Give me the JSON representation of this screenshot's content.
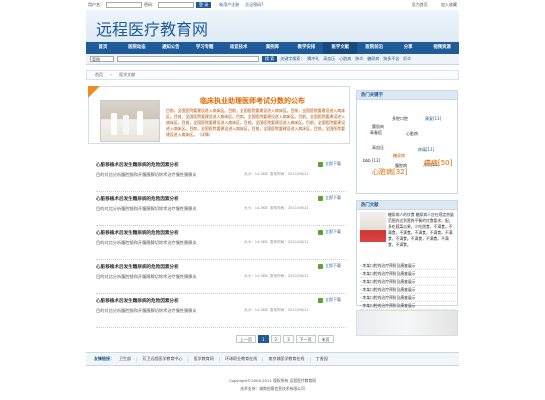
{
  "topbar": {
    "username_label": "用户名：",
    "password_label": "密码：",
    "login_button": "登 录",
    "register_link": "新用户注册",
    "forgot_link": "忘记密码?",
    "homepage_link": "设为首页",
    "favorite_link": "加入收藏"
  },
  "header": {
    "logo": "远程医疗教育网"
  },
  "nav": {
    "items": [
      "首页",
      "医院动态",
      "通知公告",
      "学习专题",
      "适宜技术",
      "案例库",
      "教学安排",
      "医学文献",
      "医院前沿",
      "分享",
      "视频资源"
    ],
    "active_index": 7
  },
  "search": {
    "select_value": "案例",
    "button": "搜 索",
    "hot_label": "关键字搜索：",
    "hot_words": [
      "腾冲孔",
      "高血压",
      "心脏病",
      "肺炎",
      "糖尿病",
      "狗多不苦",
      "肝炎"
    ]
  },
  "breadcrumb": [
    "首页",
    "医学文献"
  ],
  "featured": {
    "title": "临床执业助理医师考试分数的公布",
    "desc": "目前，全国医院要建设进入病床区。目前，全国医院要建设进入病床区。目前，全国医院要建设进入病床区。目前，全国医院要建设进入病床区。目前，全国医院要建设进入病床区。目前，全国医院要建设进入病床区。目前，全国医院要建设进入病床区。目前，全国医院要建设进入病床区。目前，全国医院要建设进入病床区。目前，全国医院要建设进入病床区。目前，全国医院要建设进入病床区。目前，全国医院要建设进入病床区。（详情）"
  },
  "articles": [
    {
      "title": "心脏移植术后发生糖尿病的危险因素分析",
      "desc": "目的对比分析腹腔镜和开腹胰腺切除术治疗慢性胰腺炎",
      "size": "大小：14.3KB",
      "date": "发布时间：2011/06/11",
      "download": "立即下载"
    },
    {
      "title": "心脏移植术后发生糖尿病的危险因素分析",
      "desc": "目的对比分析腹腔镜和开腹胰腺切除术治疗慢性胰腺炎",
      "size": "大小：14.3KB",
      "date": "发布时间：2011/06/11",
      "download": "立即下载"
    },
    {
      "title": "心脏移植术后发生糖尿病的危险因素分析",
      "desc": "目的对比分析腹腔镜和开腹胰腺切除术治疗慢性胰腺炎",
      "size": "大小：14.3KB",
      "date": "发布时间：2011/06/11",
      "download": "立即下载"
    },
    {
      "title": "心脏移植术后发生糖尿病的危险因素分析",
      "desc": "目的对比分析腹腔镜和开腹胰腺切除术治疗慢性胰腺炎",
      "size": "大小：14.3KB",
      "date": "发布时间：2011/06/11",
      "download": "立即下载"
    },
    {
      "title": "心脏移植术后发生糖尿病的危险因素分析",
      "desc": "目的对比分析腹腔镜和开腹胰腺切除术治疗慢性胰腺炎",
      "size": "大小：14.3KB",
      "date": "发布时间：2011/06/11",
      "download": "立即下载"
    }
  ],
  "pager": {
    "prev": "上一页",
    "pages": [
      "1",
      "2",
      "3"
    ],
    "current": "1",
    "next": "下一页",
    "last": "末页"
  },
  "hot_tags": {
    "title": "热门关键字",
    "tags": [
      {
        "text": "多腔口腔",
        "color": "#333333",
        "big": false
      },
      {
        "text": "青春痘",
        "color": "#333333",
        "big": false
      },
      {
        "text": "康复[11]",
        "color": "#1f5b98",
        "big": false
      },
      {
        "text": "腰肌肉",
        "color": "#333333",
        "big": false
      },
      {
        "text": "心脏病",
        "color": "#333333",
        "big": false
      },
      {
        "text": "高血压",
        "color": "#333333",
        "big": false
      },
      {
        "text": "疼痛[11]",
        "color": "#1f5b98",
        "big": false
      },
      {
        "text": "糖尿病",
        "color": "#c45a00",
        "big": false
      },
      {
        "text": "bbb [13]",
        "color": "#333333",
        "big": false
      },
      {
        "text": "儿科[51]",
        "color": "#333333",
        "big": false
      },
      {
        "text": "腹腔病",
        "color": "#333333",
        "big": false
      },
      {
        "text": "心脏病[32]",
        "color": "#e06a00",
        "big": true
      },
      {
        "text": "癌症[50]",
        "color": "#e06a00",
        "big": true
      }
    ]
  },
  "hot_docs": {
    "title": "热门文献",
    "intro": "糖尿病人的饮食 糖尿病人应在规定热量范围内达到营养平衡的饮食要求。配，多吃蔬菜瓜果，少吃甜食，不满食。不满食，不满食。不满食，不满食。不满食，不满食。不满食，不满食。不满食，不满食。",
    "list": [
      "· 李某口腔的治疗预防及康复展示",
      "· 李某口腔的治疗预防及康复展示",
      "· 李某口腔的治疗预防及康复展示",
      "· 李某口腔的治疗预防及康复展示",
      "· 李某口腔的治疗预防及康复展示",
      "· 李某口腔的治疗预防及康复展示"
    ]
  },
  "links": {
    "label": "友情链接：",
    "items": [
      "卫生部",
      "芳卫远程医学教育中心",
      "医学教育网",
      "环球职业教育在线",
      "南京城医学教育在线",
      "丁香园"
    ]
  },
  "footer": {
    "copyright": "Copyright©2009-2011  版权所有  远程医疗教育网",
    "support": "技术支持：湖南创意信息技术有限公司"
  }
}
